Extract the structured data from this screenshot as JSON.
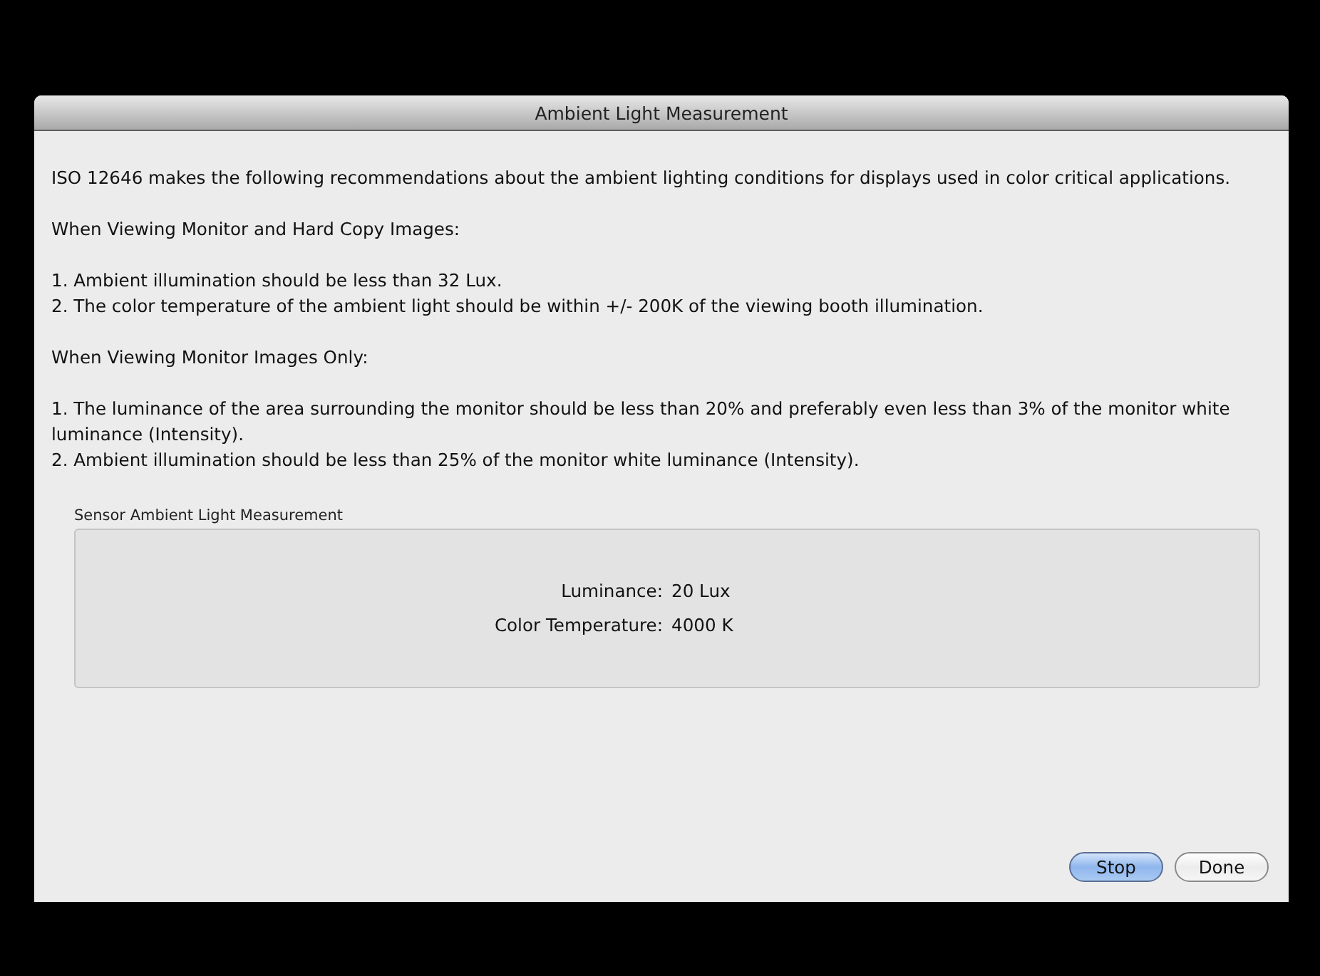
{
  "window": {
    "title": "Ambient Light Measurement"
  },
  "content": [
    {
      "kind": "paragraph",
      "text": "ISO 12646 makes the following recommendations about the ambient lighting conditions for displays used in color critical applications."
    },
    {
      "kind": "paragraph",
      "text": "When Viewing Monitor and Hard Copy Images:"
    },
    {
      "kind": "list",
      "items": [
        "1. Ambient illumination should be less than 32 Lux.",
        "2. The color temperature of the ambient light should be within +/- 200K of the viewing booth illumination."
      ]
    },
    {
      "kind": "paragraph",
      "text": "When Viewing Monitor Images Only:"
    },
    {
      "kind": "list",
      "items": [
        "1. The luminance of the area surrounding the monitor should be less than 20% and preferably even less than 3% of the monitor white luminance (Intensity).",
        "2. Ambient illumination should be less than 25% of the monitor white luminance (Intensity)."
      ]
    }
  ],
  "group": {
    "title": "Sensor Ambient Light Measurement",
    "readings": [
      {
        "label": "Luminance:",
        "value": "20 Lux"
      },
      {
        "label": "Color Temperature:",
        "value": "4000 K"
      }
    ]
  },
  "buttons": [
    {
      "label": "Stop",
      "default": true
    },
    {
      "label": "Done",
      "default": false
    }
  ]
}
